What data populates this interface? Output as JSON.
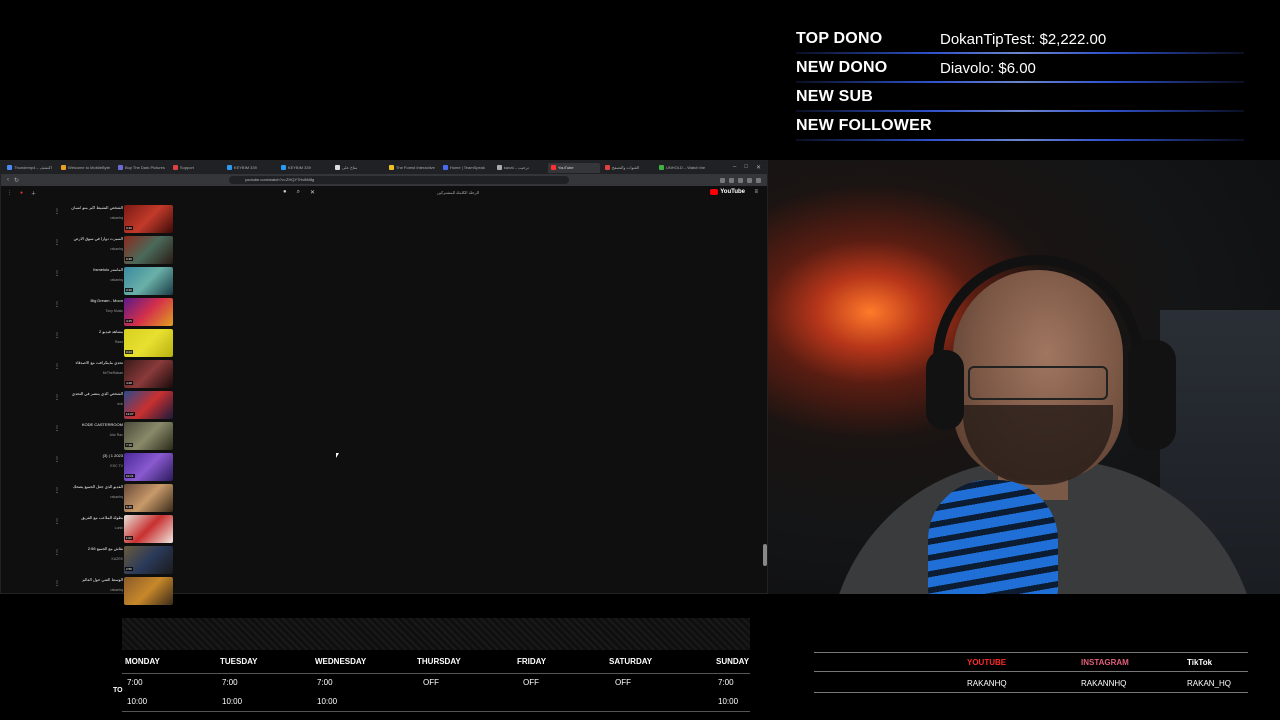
{
  "alerts": [
    {
      "label": "TOP DONO",
      "value": "DokanTipTest: $2,222.00"
    },
    {
      "label": "NEW DONO",
      "value": "Diavolo: $6.00"
    },
    {
      "label": "NEW SUB",
      "value": ""
    },
    {
      "label": "NEW FOLLOWER",
      "value": ""
    }
  ],
  "browser": {
    "tabs": [
      {
        "title": "Thundemp4 – اكتشف"
      },
      {
        "title": "Welcome to MobileByte"
      },
      {
        "title": "Buy The Dark Pictures"
      },
      {
        "title": "Support"
      },
      {
        "title": "KEYBIM 339"
      },
      {
        "title": "KEYBIM 339"
      },
      {
        "title": "متاح على"
      },
      {
        "title": "The Forest Interactive"
      },
      {
        "title": "Home | TeamSpeak"
      },
      {
        "title": "kanal – ترحيب"
      },
      {
        "title": "YouTube",
        "active": true
      },
      {
        "title": "القنوات والتصفح"
      },
      {
        "title": "UNHOLD – Watch the"
      }
    ],
    "url": "youtube.com/watch?v=ZHQY7Hv8M8g",
    "yt_header_title": "الرحلة الكاملة للمشتركين",
    "yt_logo": "YouTube",
    "playlist": [
      {
        "title": "الشخص النشيط اكبر منو انسان",
        "channel": "rakanhq",
        "duration": "0:40",
        "thumb": "linear-gradient(135deg,#7a1a14,#c23a2a,#3b0b08)"
      },
      {
        "title": "السبرت دوارا في سوق الارض",
        "channel": "rakanhq",
        "duration": "0:39",
        "thumb": "linear-gradient(135deg,#8a2a1e,#4a6a5a,#2a1a14)"
      },
      {
        "title": "Itsmelolo الماستر",
        "channel": "rakanhq",
        "duration": "0:40",
        "thumb": "linear-gradient(135deg,#3a8aa0,#6ab0a8,#1a3a44)"
      },
      {
        "title": "Big Dream - Moon",
        "channel": "Tony Music",
        "duration": "4:15",
        "thumb": "linear-gradient(135deg,#5a1a8a,#d4304a,#e0a020)"
      },
      {
        "title": "2 مشاهد فيديو",
        "channel": "Rawr",
        "duration": "0:23",
        "thumb": "linear-gradient(135deg,#d8d020,#e8e030,#b8b010)"
      },
      {
        "title": "تحدي ماينكرافت مع الاصدقاء",
        "channel": "MrTheRakan",
        "duration": "4:28",
        "thumb": "linear-gradient(135deg,#3a1a1a,#8a3a3a,#1a0a0a)"
      },
      {
        "title": "الشخص الذي ينتصر في التحدي",
        "channel": "ecb",
        "duration": "12:07",
        "thumb": "linear-gradient(135deg,#2a4a8a,#c83030,#1a1a3a)"
      },
      {
        "title": "KODE CASTERROOM",
        "channel": "Alor Rac",
        "duration": "7:18",
        "thumb": "linear-gradient(135deg,#4a4a3a,#8a8a6a,#2a2a1a)"
      },
      {
        "title": "(3) | 1 2023",
        "channel": "ESC TV",
        "duration": "10:21",
        "thumb": "linear-gradient(135deg,#4a2a9a,#8a5ad0,#2a1a5a)"
      },
      {
        "title": "الفديو الذي جعل الجميع يضحك",
        "channel": "rakanhq",
        "duration": "6:45",
        "thumb": "linear-gradient(135deg,#6a4a3a,#c89a6a,#3a2a1a)"
      },
      {
        "title": "بطولة الملاعب مع الفريق",
        "channel": "Lunix",
        "duration": "1:02",
        "thumb": "linear-gradient(135deg,#e8e0d8,#c83030,#f0e8e0)"
      },
      {
        "title": "2:56 نقاش مع الجميع",
        "channel": "KAZEK",
        "duration": "2:56",
        "thumb": "linear-gradient(135deg,#6a5a3a,#2a3a5a,#1a1a1a)"
      },
      {
        "title": "الوسط الفني حول العالم",
        "channel": "rakanhq",
        "duration": "",
        "thumb": "linear-gradient(135deg,#8a5a2a,#c8882a,#3a2a1a)"
      }
    ]
  },
  "schedule": {
    "to_label": "TO",
    "days": [
      {
        "day": "MONDAY",
        "start": "7:00",
        "end": "10:00"
      },
      {
        "day": "TUESDAY",
        "start": "7:00",
        "end": "10:00"
      },
      {
        "day": "WEDNESDAY",
        "start": "7:00",
        "end": "10:00"
      },
      {
        "day": "THURSDAY",
        "start": "OFF",
        "end": ""
      },
      {
        "day": "FRIDAY",
        "start": "OFF",
        "end": ""
      },
      {
        "day": "SATURDAY",
        "start": "OFF",
        "end": ""
      },
      {
        "day": "SUNDAY",
        "start": "7:00",
        "end": "10:00"
      }
    ]
  },
  "socials": [
    {
      "name": "YOUTUBE",
      "handle": "RAKANHQ",
      "color": "#ff2a2a"
    },
    {
      "name": "INSTAGRAM",
      "handle": "RAKANNHQ",
      "color": "#e0607a"
    },
    {
      "name": "TikTok",
      "handle": "RAKAN_HQ",
      "color": "#ffffff"
    }
  ]
}
